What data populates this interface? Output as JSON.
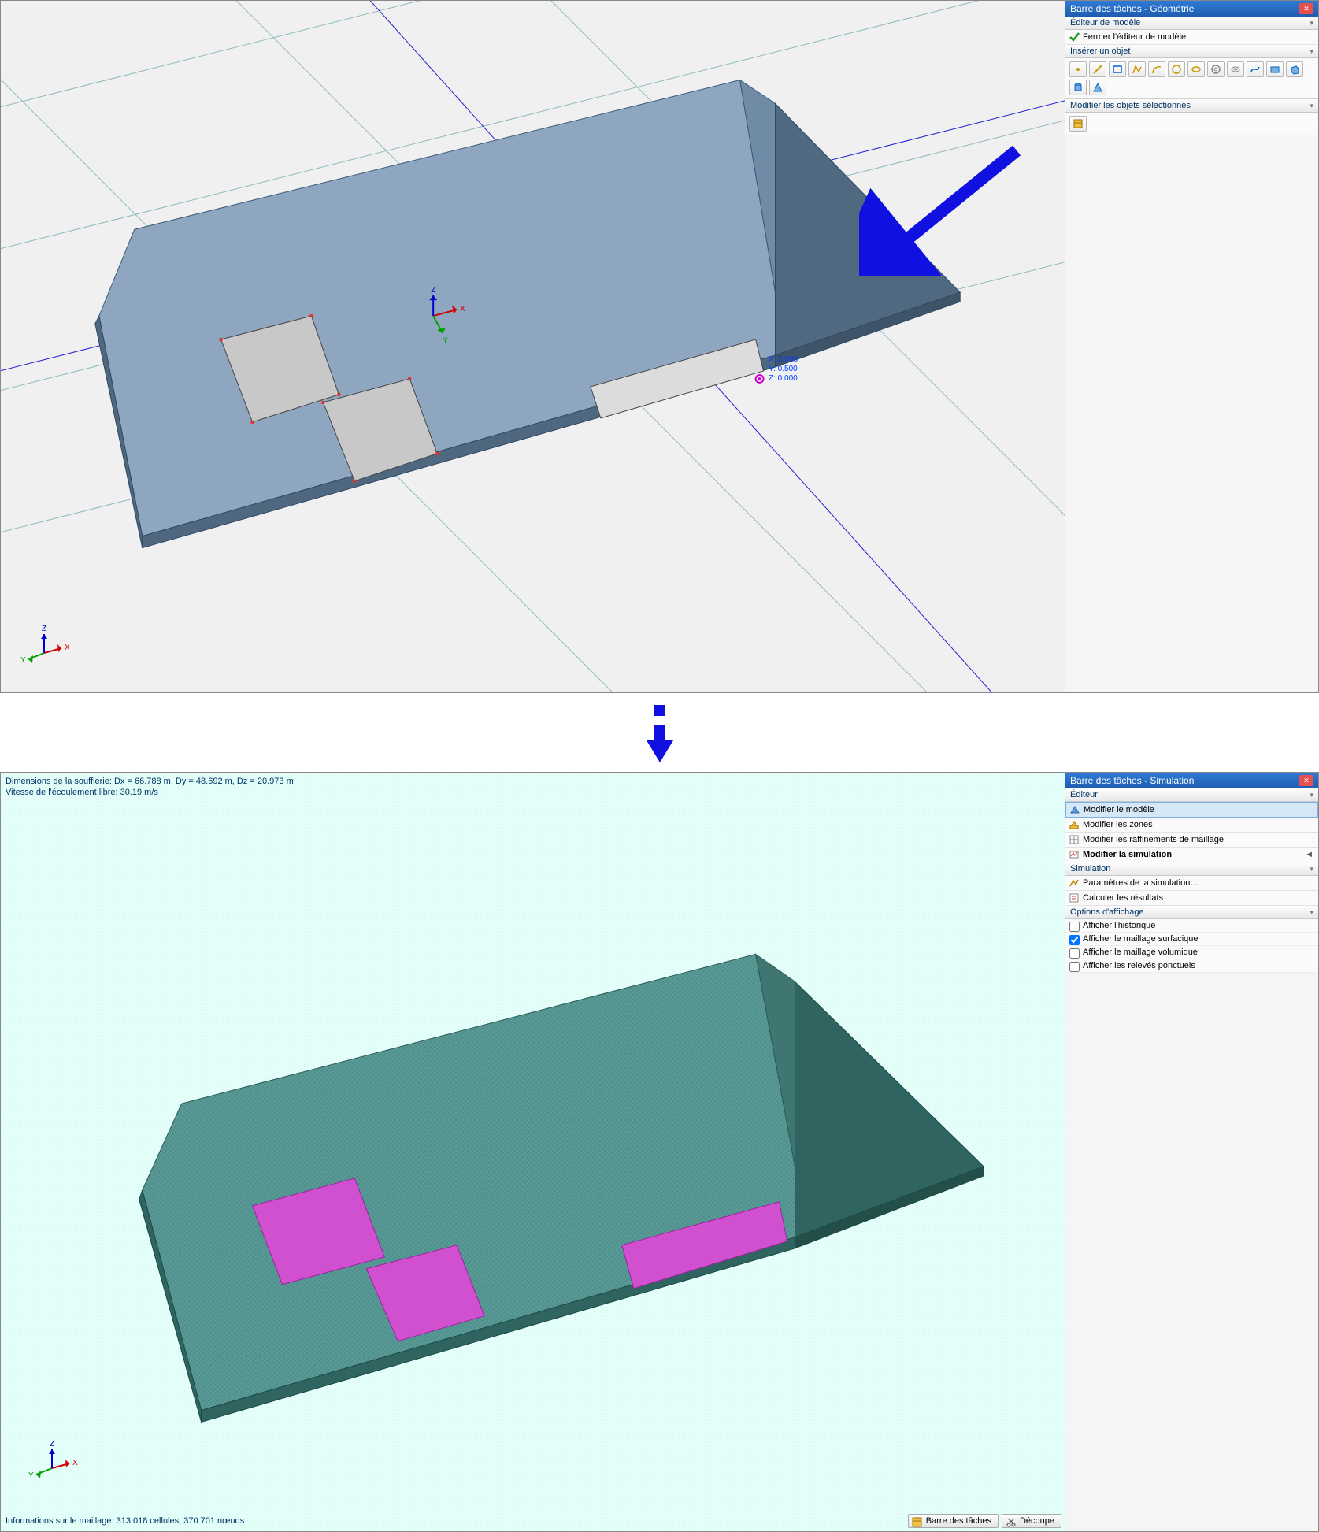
{
  "top": {
    "panel_title": "Barre des tâches - Géométrie",
    "section_editor": "Éditeur de modèle",
    "close_editor": "Fermer l'éditeur de modèle",
    "section_insert": "Insérer un objet",
    "section_modify": "Modifier les objets sélectionnés",
    "coords": {
      "x": "X: 5.000",
      "y": "Y: 0.500",
      "z": "Z: 0.000"
    },
    "axes": {
      "x": "X",
      "y": "Y",
      "z": "Z"
    }
  },
  "bottom": {
    "panel_title": "Barre des tâches - Simulation",
    "section_editor": "Éditeur",
    "items_editor": [
      "Modifier le modèle",
      "Modifier les zones",
      "Modifier les raffinements de maillage",
      "Modifier la simulation"
    ],
    "section_simulation": "Simulation",
    "items_sim": [
      "Paramètres de la simulation…",
      "Calculer les résultats"
    ],
    "section_display": "Options d'affichage",
    "items_display": [
      "Afficher l'historique",
      "Afficher le maillage surfacique",
      "Afficher le maillage volumique",
      "Afficher les relevés ponctuels"
    ],
    "info_top": "Dimensions de la soufflerie: Dx = 66.788 m, Dy = 48.692 m, Dz = 20.973 m",
    "info_speed": "Vitesse de l'écoulement libre: 30.19 m/s",
    "info_mesh": "Informations sur le maillage: 313 018 cellules, 370 701 nœuds",
    "footer_btn1": "Barre des tâches",
    "footer_btn2": "Découpe",
    "axes": {
      "x": "X",
      "y": "Y",
      "z": "Z"
    }
  }
}
